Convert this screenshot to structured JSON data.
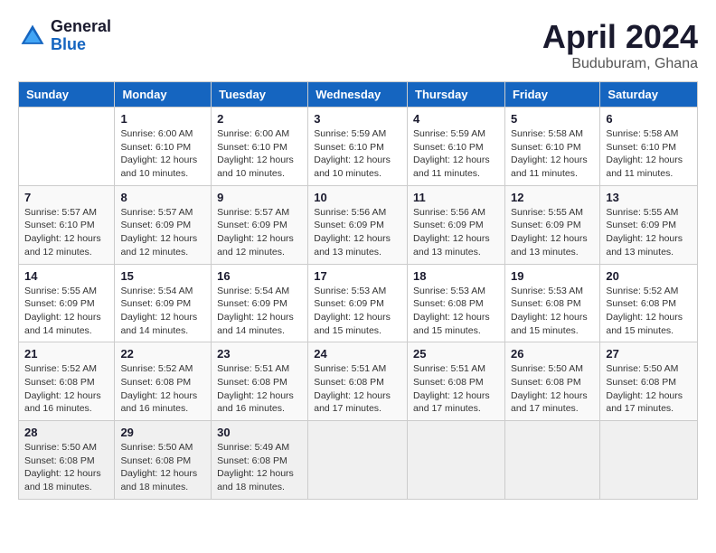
{
  "header": {
    "logo_general": "General",
    "logo_blue": "Blue",
    "title": "April 2024",
    "location": "Buduburam, Ghana"
  },
  "weekdays": [
    "Sunday",
    "Monday",
    "Tuesday",
    "Wednesday",
    "Thursday",
    "Friday",
    "Saturday"
  ],
  "weeks": [
    [
      {
        "day": "",
        "sunrise": "",
        "sunset": "",
        "daylight": ""
      },
      {
        "day": "1",
        "sunrise": "Sunrise: 6:00 AM",
        "sunset": "Sunset: 6:10 PM",
        "daylight": "Daylight: 12 hours and 10 minutes."
      },
      {
        "day": "2",
        "sunrise": "Sunrise: 6:00 AM",
        "sunset": "Sunset: 6:10 PM",
        "daylight": "Daylight: 12 hours and 10 minutes."
      },
      {
        "day": "3",
        "sunrise": "Sunrise: 5:59 AM",
        "sunset": "Sunset: 6:10 PM",
        "daylight": "Daylight: 12 hours and 10 minutes."
      },
      {
        "day": "4",
        "sunrise": "Sunrise: 5:59 AM",
        "sunset": "Sunset: 6:10 PM",
        "daylight": "Daylight: 12 hours and 11 minutes."
      },
      {
        "day": "5",
        "sunrise": "Sunrise: 5:58 AM",
        "sunset": "Sunset: 6:10 PM",
        "daylight": "Daylight: 12 hours and 11 minutes."
      },
      {
        "day": "6",
        "sunrise": "Sunrise: 5:58 AM",
        "sunset": "Sunset: 6:10 PM",
        "daylight": "Daylight: 12 hours and 11 minutes."
      }
    ],
    [
      {
        "day": "7",
        "sunrise": "Sunrise: 5:57 AM",
        "sunset": "Sunset: 6:10 PM",
        "daylight": "Daylight: 12 hours and 12 minutes."
      },
      {
        "day": "8",
        "sunrise": "Sunrise: 5:57 AM",
        "sunset": "Sunset: 6:09 PM",
        "daylight": "Daylight: 12 hours and 12 minutes."
      },
      {
        "day": "9",
        "sunrise": "Sunrise: 5:57 AM",
        "sunset": "Sunset: 6:09 PM",
        "daylight": "Daylight: 12 hours and 12 minutes."
      },
      {
        "day": "10",
        "sunrise": "Sunrise: 5:56 AM",
        "sunset": "Sunset: 6:09 PM",
        "daylight": "Daylight: 12 hours and 13 minutes."
      },
      {
        "day": "11",
        "sunrise": "Sunrise: 5:56 AM",
        "sunset": "Sunset: 6:09 PM",
        "daylight": "Daylight: 12 hours and 13 minutes."
      },
      {
        "day": "12",
        "sunrise": "Sunrise: 5:55 AM",
        "sunset": "Sunset: 6:09 PM",
        "daylight": "Daylight: 12 hours and 13 minutes."
      },
      {
        "day": "13",
        "sunrise": "Sunrise: 5:55 AM",
        "sunset": "Sunset: 6:09 PM",
        "daylight": "Daylight: 12 hours and 13 minutes."
      }
    ],
    [
      {
        "day": "14",
        "sunrise": "Sunrise: 5:55 AM",
        "sunset": "Sunset: 6:09 PM",
        "daylight": "Daylight: 12 hours and 14 minutes."
      },
      {
        "day": "15",
        "sunrise": "Sunrise: 5:54 AM",
        "sunset": "Sunset: 6:09 PM",
        "daylight": "Daylight: 12 hours and 14 minutes."
      },
      {
        "day": "16",
        "sunrise": "Sunrise: 5:54 AM",
        "sunset": "Sunset: 6:09 PM",
        "daylight": "Daylight: 12 hours and 14 minutes."
      },
      {
        "day": "17",
        "sunrise": "Sunrise: 5:53 AM",
        "sunset": "Sunset: 6:09 PM",
        "daylight": "Daylight: 12 hours and 15 minutes."
      },
      {
        "day": "18",
        "sunrise": "Sunrise: 5:53 AM",
        "sunset": "Sunset: 6:08 PM",
        "daylight": "Daylight: 12 hours and 15 minutes."
      },
      {
        "day": "19",
        "sunrise": "Sunrise: 5:53 AM",
        "sunset": "Sunset: 6:08 PM",
        "daylight": "Daylight: 12 hours and 15 minutes."
      },
      {
        "day": "20",
        "sunrise": "Sunrise: 5:52 AM",
        "sunset": "Sunset: 6:08 PM",
        "daylight": "Daylight: 12 hours and 15 minutes."
      }
    ],
    [
      {
        "day": "21",
        "sunrise": "Sunrise: 5:52 AM",
        "sunset": "Sunset: 6:08 PM",
        "daylight": "Daylight: 12 hours and 16 minutes."
      },
      {
        "day": "22",
        "sunrise": "Sunrise: 5:52 AM",
        "sunset": "Sunset: 6:08 PM",
        "daylight": "Daylight: 12 hours and 16 minutes."
      },
      {
        "day": "23",
        "sunrise": "Sunrise: 5:51 AM",
        "sunset": "Sunset: 6:08 PM",
        "daylight": "Daylight: 12 hours and 16 minutes."
      },
      {
        "day": "24",
        "sunrise": "Sunrise: 5:51 AM",
        "sunset": "Sunset: 6:08 PM",
        "daylight": "Daylight: 12 hours and 17 minutes."
      },
      {
        "day": "25",
        "sunrise": "Sunrise: 5:51 AM",
        "sunset": "Sunset: 6:08 PM",
        "daylight": "Daylight: 12 hours and 17 minutes."
      },
      {
        "day": "26",
        "sunrise": "Sunrise: 5:50 AM",
        "sunset": "Sunset: 6:08 PM",
        "daylight": "Daylight: 12 hours and 17 minutes."
      },
      {
        "day": "27",
        "sunrise": "Sunrise: 5:50 AM",
        "sunset": "Sunset: 6:08 PM",
        "daylight": "Daylight: 12 hours and 17 minutes."
      }
    ],
    [
      {
        "day": "28",
        "sunrise": "Sunrise: 5:50 AM",
        "sunset": "Sunset: 6:08 PM",
        "daylight": "Daylight: 12 hours and 18 minutes."
      },
      {
        "day": "29",
        "sunrise": "Sunrise: 5:50 AM",
        "sunset": "Sunset: 6:08 PM",
        "daylight": "Daylight: 12 hours and 18 minutes."
      },
      {
        "day": "30",
        "sunrise": "Sunrise: 5:49 AM",
        "sunset": "Sunset: 6:08 PM",
        "daylight": "Daylight: 12 hours and 18 minutes."
      },
      {
        "day": "",
        "sunrise": "",
        "sunset": "",
        "daylight": ""
      },
      {
        "day": "",
        "sunrise": "",
        "sunset": "",
        "daylight": ""
      },
      {
        "day": "",
        "sunrise": "",
        "sunset": "",
        "daylight": ""
      },
      {
        "day": "",
        "sunrise": "",
        "sunset": "",
        "daylight": ""
      }
    ]
  ]
}
